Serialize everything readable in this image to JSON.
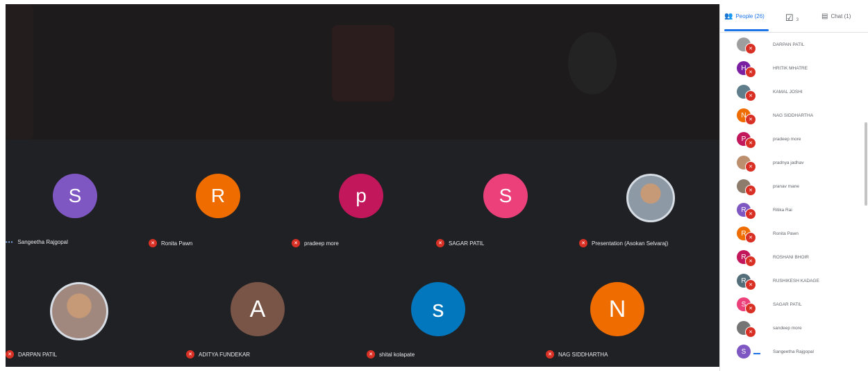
{
  "colors": {
    "stage_bg": "#202124",
    "muted": "#d93025",
    "accent": "#1a73e8"
  },
  "tiles_row1": [
    {
      "initial": "S",
      "color": "#7e57c2",
      "name": "Sangeetha Rajgopal",
      "status": "speaking-dots"
    },
    {
      "initial": "R",
      "color": "#ef6c00",
      "name": "Ronita Pawn",
      "status": "muted"
    },
    {
      "initial": "p",
      "color": "#c2185b",
      "name": "pradeep more",
      "status": "muted"
    },
    {
      "initial": "S",
      "color": "#ec407a",
      "name": "SAGAR PATIL",
      "status": "muted"
    },
    {
      "initial": "",
      "color": "#8d9aa6",
      "name": "Presentation (Asokan Selvaraj)",
      "status": "muted",
      "photo": true
    }
  ],
  "tiles_row2": [
    {
      "initial": "",
      "color": "#a1887f",
      "name": "DARPAN PATIL",
      "status": "muted",
      "photo": true
    },
    {
      "initial": "A",
      "color": "#795548",
      "name": "ADITYA FUNDEKAR",
      "status": "muted"
    },
    {
      "initial": "s",
      "color": "#0277bd",
      "name": "shital kolapate",
      "status": "muted"
    },
    {
      "initial": "N",
      "color": "#ef6c00",
      "name": "NAG SIDDHARTHA",
      "status": "muted"
    }
  ],
  "panel": {
    "tabs": {
      "people": "People (26)",
      "tasks_count": "3",
      "chat": "Chat (1)"
    },
    "participants": [
      {
        "initial": "",
        "color": "#9e9e9e",
        "name": "DARPAN PATIL",
        "photo": true
      },
      {
        "initial": "H",
        "color": "#7b1fa2",
        "name": "HRITIK MHATRE"
      },
      {
        "initial": "",
        "color": "#607d8b",
        "name": "KAMAL JOSHI",
        "photo": true
      },
      {
        "initial": "N",
        "color": "#ef6c00",
        "name": "NAG SIDDHARTHA"
      },
      {
        "initial": "P",
        "color": "#c2185b",
        "name": "pradeep more"
      },
      {
        "initial": "",
        "color": "#bc8f6f",
        "name": "pradnya jadhav",
        "photo": true
      },
      {
        "initial": "",
        "color": "#8d7b6b",
        "name": "pranav mane",
        "photo": true
      },
      {
        "initial": "R",
        "color": "#7e57c2",
        "name": "Ritika Rai"
      },
      {
        "initial": "R",
        "color": "#ef6c00",
        "name": "Ronita Pawn"
      },
      {
        "initial": "R",
        "color": "#c2185b",
        "name": "ROSHANI BHOIR"
      },
      {
        "initial": "R",
        "color": "#546e7a",
        "name": "RUSHIKESH KADAGE"
      },
      {
        "initial": "S",
        "color": "#ec407a",
        "name": "SAGAR PATIL"
      },
      {
        "initial": "",
        "color": "#757575",
        "name": "sandeep more",
        "photo": true
      },
      {
        "initial": "S",
        "color": "#7e57c2",
        "name": "Sangeetha Rajgopal",
        "speaking": true
      }
    ]
  }
}
